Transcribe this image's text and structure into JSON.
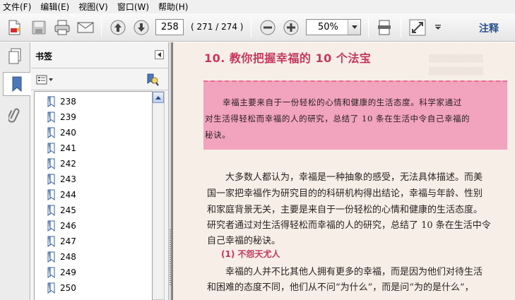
{
  "menu": [
    {
      "label": "文件(F)"
    },
    {
      "label": "编辑(E)"
    },
    {
      "label": "视图(V)"
    },
    {
      "label": "窗口(W)"
    },
    {
      "label": "帮助(H)"
    }
  ],
  "toolbar": {
    "current_page": "258",
    "page_count": "( 271 / 274 )",
    "zoom": "50%",
    "annotate_label": "注释"
  },
  "icons": {
    "create": "create-pdf-icon",
    "save": "save-icon",
    "print": "print-icon",
    "email": "email-icon",
    "prev": "previous-page-icon",
    "next": "next-page-icon",
    "zoom_out": "zoom-out-icon",
    "zoom_in": "zoom-in-icon",
    "fit": "fit-page-icon",
    "fullscreen": "full-screen-icon"
  },
  "panel": {
    "title": "书签",
    "bookmarks": [
      {
        "label": "238"
      },
      {
        "label": "239"
      },
      {
        "label": "240"
      },
      {
        "label": "241"
      },
      {
        "label": "242"
      },
      {
        "label": "243"
      },
      {
        "label": "244"
      },
      {
        "label": "245"
      },
      {
        "label": "246"
      },
      {
        "label": "247"
      },
      {
        "label": "248"
      },
      {
        "label": "249"
      },
      {
        "label": "250"
      }
    ]
  },
  "document": {
    "heading": "10. 教你把握幸福的 10 个法宝",
    "summary_lines": [
      "幸福主要来自于一份轻松的心情和健康的生活态度。科学家通过",
      "对生活得轻松而幸福的人的研究，总结了 10 条在生活中令自己幸福的",
      "秘诀。"
    ],
    "body_lines": [
      "大多数人都认为，幸福是一种抽象的感受，无法具体描述。而美",
      "国一家把幸福作为研究目的的科研机构得出结论，幸福与年龄、性别",
      "和家庭背景无关，主要是来自于一份轻松的心情和健康的生活态度。",
      "研究者通过对生活得轻松而幸福的人的研究，总结了 10 条在生活中令",
      "自己幸福的秘诀。"
    ],
    "subheading": "(1) 不怨天尤人",
    "body2_lines": [
      "幸福的人并不比其他人拥有更多的幸福，而是因为他们对待生活",
      "和困难的态度不同，他们从不问“为什么”，而是问“为的是什么”，"
    ]
  },
  "colors": {
    "heading": "#c6375a",
    "pink_box": "#f2a3bd",
    "page_bg": "#f7eee7",
    "annotate": "#27508f"
  }
}
